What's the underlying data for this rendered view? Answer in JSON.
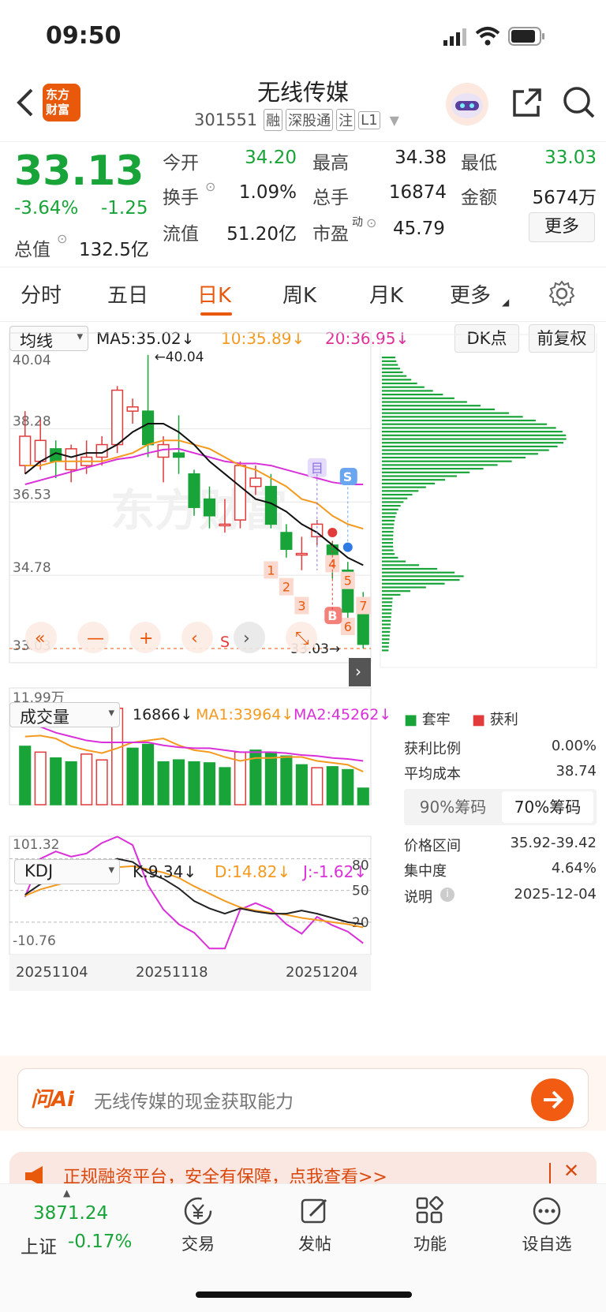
{
  "status": {
    "time": "09:50"
  },
  "header": {
    "title": "无线传媒",
    "code": "301551",
    "tags": [
      "融",
      "深股通",
      "注",
      "L1"
    ],
    "logo_lines": [
      "东方",
      "财富"
    ]
  },
  "quote": {
    "price": "33.13",
    "change_pct": "-3.64%",
    "change": "-1.25",
    "open_label": "今开",
    "open": "34.20",
    "high_label": "最高",
    "high": "34.38",
    "low_label": "最低",
    "low": "33.03",
    "turnover_label": "换手",
    "turnover": "1.09%",
    "volume_label": "总手",
    "volume": "16874",
    "amount_label": "金额",
    "amount": "5674万",
    "mktcap_label": "总值",
    "mktcap": "132.5亿",
    "float_label": "流值",
    "float": "51.20亿",
    "pe_label": "市盈",
    "pe_sup": "动",
    "pe": "45.79",
    "more_label": "更多"
  },
  "tabs": [
    {
      "label": "分时"
    },
    {
      "label": "五日"
    },
    {
      "label": "日K"
    },
    {
      "label": "周K"
    },
    {
      "label": "月K"
    },
    {
      "label": "更多"
    }
  ],
  "ma_bar": {
    "selector": "均线",
    "ma5": "MA5:35.02↓",
    "ma10": "10:35.89↓",
    "ma20": "20:36.95↓",
    "dk_label": "DK点",
    "adj_label": "前复权"
  },
  "volume_bar": {
    "selector": "成交量",
    "vol": "16866↓",
    "ma1": "MA1:33964↓",
    "ma2": "MA2:45262↓"
  },
  "kdj_bar": {
    "selector": "KDJ",
    "k": "K:9.34↓",
    "d": "D:14.82↓",
    "j": "J:-1.62↓"
  },
  "chart_data": [
    {
      "type": "candlestick",
      "y_axis_labels": [
        "40.04",
        "38.28",
        "36.53",
        "34.78",
        "33.03"
      ],
      "max_marker": "40.04",
      "min_marker": "33.03",
      "signal_labels": [
        "1",
        "2",
        "3",
        "4",
        "5",
        "6",
        "7",
        "B",
        "S",
        "S",
        "目"
      ],
      "watermark": "东方财富",
      "candles": [
        {
          "o": 37.4,
          "c": 38.1,
          "h": 38.7,
          "l": 37.2
        },
        {
          "o": 37.5,
          "c": 38.0,
          "h": 38.5,
          "l": 37.3
        },
        {
          "o": 37.8,
          "c": 37.5,
          "h": 38.0,
          "l": 37.1
        },
        {
          "o": 37.3,
          "c": 37.8,
          "h": 37.9,
          "l": 37.0
        },
        {
          "o": 37.4,
          "c": 37.6,
          "h": 38.0,
          "l": 37.2
        },
        {
          "o": 37.6,
          "c": 37.9,
          "h": 38.1,
          "l": 37.4
        },
        {
          "o": 37.9,
          "c": 39.2,
          "h": 39.3,
          "l": 37.7
        },
        {
          "o": 38.7,
          "c": 38.8,
          "h": 39.0,
          "l": 38.4
        },
        {
          "o": 38.7,
          "c": 37.9,
          "h": 40.04,
          "l": 37.6
        },
        {
          "o": 37.6,
          "c": 37.9,
          "h": 38.1,
          "l": 37.0
        },
        {
          "o": 37.7,
          "c": 37.6,
          "h": 38.6,
          "l": 37.2
        },
        {
          "o": 37.2,
          "c": 36.4,
          "h": 37.3,
          "l": 36.2
        },
        {
          "o": 36.6,
          "c": 36.2,
          "h": 36.9,
          "l": 35.9
        },
        {
          "o": 36.0,
          "c": 36.0,
          "h": 36.6,
          "l": 35.8
        },
        {
          "o": 36.1,
          "c": 37.4,
          "h": 37.5,
          "l": 35.9
        },
        {
          "o": 36.9,
          "c": 37.1,
          "h": 37.4,
          "l": 36.7
        },
        {
          "o": 36.9,
          "c": 36.0,
          "h": 37.2,
          "l": 35.9
        },
        {
          "o": 35.8,
          "c": 35.4,
          "h": 36.0,
          "l": 35.2
        },
        {
          "o": 35.3,
          "c": 35.3,
          "h": 35.7,
          "l": 34.9
        },
        {
          "o": 35.7,
          "c": 36.0,
          "h": 36.1,
          "l": 35.5
        },
        {
          "o": 35.5,
          "c": 34.9,
          "h": 35.6,
          "l": 34.7
        },
        {
          "o": 34.9,
          "c": 33.9,
          "h": 35.1,
          "l": 33.7
        },
        {
          "o": 34.2,
          "c": 33.13,
          "h": 34.38,
          "l": 33.03
        }
      ],
      "ma5": [
        37.2,
        37.5,
        37.7,
        37.6,
        37.7,
        37.7,
        37.9,
        38.2,
        38.4,
        38.4,
        38.2,
        37.9,
        37.5,
        37.2,
        36.9,
        36.6,
        36.5,
        36.3,
        36.0,
        35.8,
        35.5,
        35.2,
        35.02
      ],
      "ma10": [
        37.4,
        37.4,
        37.5,
        37.5,
        37.5,
        37.5,
        37.6,
        37.7,
        37.9,
        38.0,
        38.0,
        37.9,
        37.8,
        37.6,
        37.4,
        37.3,
        37.1,
        36.9,
        36.6,
        36.5,
        36.2,
        36.0,
        35.89
      ],
      "ma20": [
        36.95,
        37.05,
        37.15,
        37.25,
        37.35,
        37.45,
        37.55,
        37.6,
        37.7,
        37.78,
        37.8,
        37.7,
        37.6,
        37.5,
        37.45,
        37.45,
        37.4,
        37.3,
        37.2,
        37.1,
        37.0,
        36.95,
        36.95
      ]
    },
    {
      "type": "bar",
      "y_axis_labels": [
        "11.99万"
      ],
      "values": [
        6.0,
        5.4,
        4.8,
        4.4,
        5.2,
        4.6,
        9.9,
        5.8,
        6.2,
        4.4,
        4.6,
        4.4,
        4.3,
        3.8,
        5.4,
        5.6,
        5.4,
        5.0,
        4.1,
        3.8,
        3.9,
        3.6,
        1.7
      ],
      "rising": [
        false,
        true,
        false,
        false,
        true,
        true,
        true,
        false,
        false,
        false,
        false,
        false,
        false,
        false,
        true,
        false,
        false,
        false,
        false,
        true,
        false,
        false,
        false
      ],
      "ma1": [
        7.0,
        7.1,
        6.8,
        6.0,
        5.6,
        5.3,
        5.8,
        6.4,
        6.6,
        6.8,
        6.1,
        5.6,
        5.4,
        4.9,
        4.5,
        4.8,
        4.8,
        4.9,
        4.9,
        4.5,
        4.3,
        4.1,
        3.4
      ],
      "ma2": [
        8.6,
        8.0,
        7.4,
        7.0,
        6.6,
        6.4,
        6.4,
        6.4,
        6.4,
        6.1,
        5.9,
        5.8,
        5.8,
        5.6,
        5.4,
        5.4,
        5.4,
        5.3,
        5.1,
        5.0,
        4.8,
        4.7,
        4.5
      ]
    },
    {
      "type": "line",
      "x_tick_labels": [
        "20251104",
        "20251118",
        "20251204"
      ],
      "y_axis_labels": [
        "101.32",
        "-10.76"
      ],
      "right_axis_labels": [
        "80",
        "50",
        "20"
      ],
      "series": [
        {
          "name": "K",
          "values": [
            46,
            56,
            62,
            65,
            68,
            73,
            80,
            77,
            67,
            61,
            52,
            40,
            33,
            28,
            33,
            30,
            28,
            28,
            31,
            28,
            24,
            20,
            18
          ]
        },
        {
          "name": "D",
          "values": [
            45,
            51,
            55,
            59,
            62,
            66,
            72,
            73,
            70,
            67,
            62,
            54,
            47,
            40,
            34,
            31,
            29,
            27,
            24,
            22,
            20,
            18,
            15
          ]
        },
        {
          "name": "J",
          "values": [
            44,
            80,
            87,
            82,
            85,
            95,
            101,
            93,
            55,
            32,
            18,
            10,
            -5,
            -5,
            32,
            38,
            32,
            18,
            9,
            25,
            17,
            11,
            0
          ]
        }
      ]
    }
  ],
  "chip": {
    "legend_hold": "套牢",
    "legend_profit": "获利",
    "profit_ratio_label": "获利比例",
    "profit_ratio": "0.00%",
    "avg_cost_label": "平均成本",
    "avg_cost": "38.74",
    "tab90": "90%筹码",
    "tab70": "70%筹码",
    "range_label": "价格区间",
    "range": "35.92-39.42",
    "concentration_label": "集中度",
    "concentration": "4.64%",
    "note_label": "说明",
    "date": "2025-12-04"
  },
  "ai": {
    "logo": "问Ai",
    "placeholder": "无线传媒的现金获取能力"
  },
  "banner": {
    "text": "正规融资平台，安全有保障，点我查看>>"
  },
  "bottom": {
    "index_value": "3871.24",
    "index_name": "上证",
    "index_change": "-0.17%",
    "nav": [
      {
        "label": "交易"
      },
      {
        "label": "发帖"
      },
      {
        "label": "功能"
      },
      {
        "label": "设自选"
      }
    ]
  },
  "colors": {
    "up": "#e23b3b",
    "down": "#18a438",
    "accent": "#e8590c",
    "ma10": "#f39a1f",
    "ma20": "#d930d9"
  }
}
